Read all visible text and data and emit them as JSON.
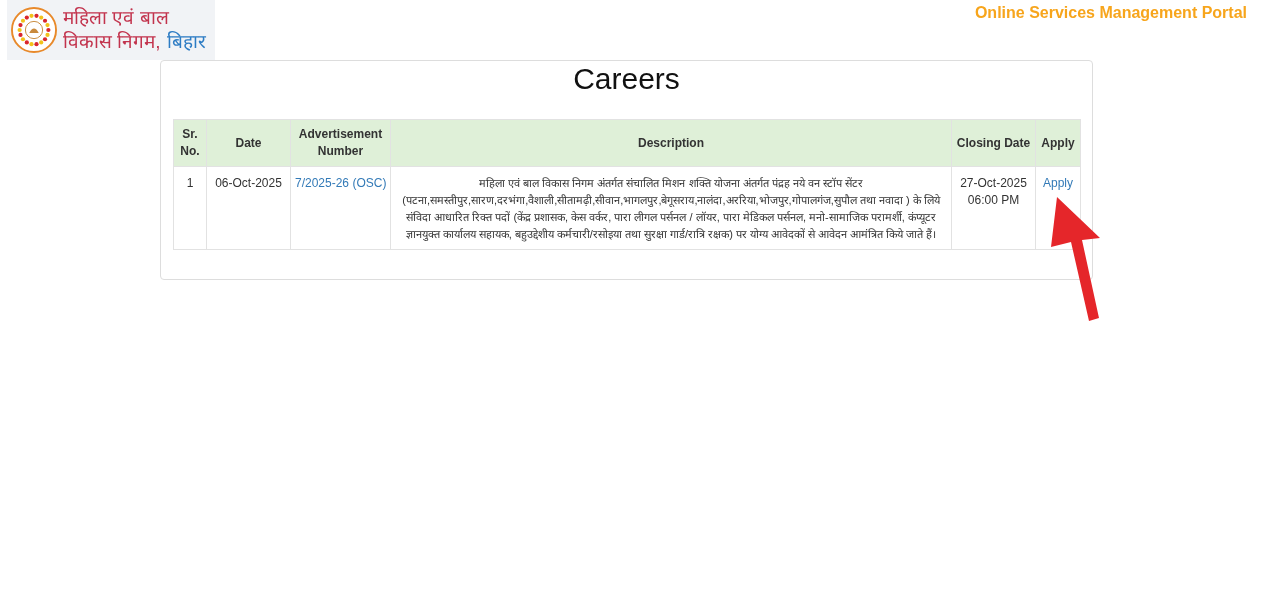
{
  "header": {
    "logo": {
      "line_1": "महिला एवं बाल",
      "line_2": "विकास निगम,",
      "line_2_accent": "बिहार"
    },
    "portal_title": "Online Services Management Portal"
  },
  "page": {
    "title": "Careers",
    "table": {
      "columns": [
        "Sr. No.",
        "Date",
        "Advertisement Number",
        "Description",
        "Closing Date",
        "Apply"
      ],
      "rows": [
        {
          "sr_no": "1",
          "date": "06-Oct-2025",
          "advertisement_number": "7/2025-26 (OSC)",
          "description": "महिला एवं बाल विकास निगम अंतर्गत संचालित मिशन शक्ति योजना अंतर्गत पंद्रह नये वन स्टॉप सेंटर (पटना,समस्तीपुर,सारण,दरभंगा,वैशाली,सीतामढ़ी,सीवान,भागलपुर,बेगूसराय,नालंदा,अररिया,भोजपुर,गोपालगंज,सुपौल तथा नवादा ) के लिये संविदा आधारित रिक्त पदों (केंद्र प्रशासक, केस वर्कर, पारा लीगल पर्सनल / लॉयर, पारा मेडिकल पर्सनल, मनो-सामाजिक परामर्शी, कंप्यूटर ज्ञानयुक्त कार्यालय सहायक, बहुउद्देशीय कर्मचारी/रसोइया तथा सुरक्षा गार्ड/रात्रि रक्षक) पर योग्य आवेदकों से आवेदन आमंत्रित किये जाते हैं।",
          "closing_date": "27-Oct-2025 06:00 PM",
          "apply": "Apply"
        }
      ]
    }
  }
}
